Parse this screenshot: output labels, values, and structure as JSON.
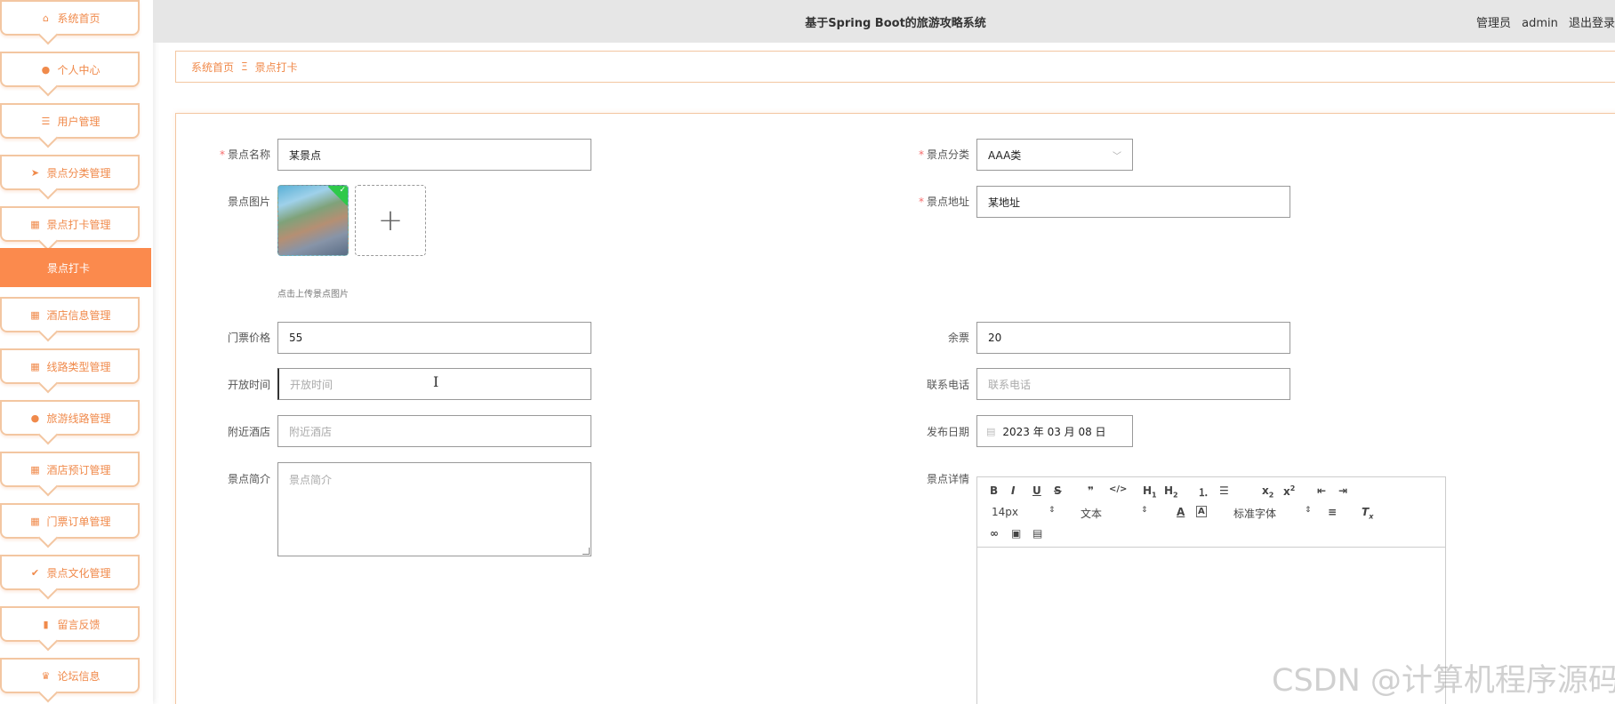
{
  "app": {
    "title": "基于Spring Boot的旅游攻略系统"
  },
  "header": {
    "role": "管理员",
    "username": "admin",
    "logout": "退出登录"
  },
  "sidebar": {
    "items": [
      {
        "label": "系统首页",
        "icon": "home-icon",
        "glyph": "⌂"
      },
      {
        "label": "个人中心",
        "icon": "user-icon",
        "glyph": "●"
      },
      {
        "label": "用户管理",
        "icon": "list-icon",
        "glyph": "☰"
      },
      {
        "label": "景点分类管理",
        "icon": "send-icon",
        "glyph": "➤"
      },
      {
        "label": "景点打卡管理",
        "icon": "grid-icon",
        "glyph": "▦"
      },
      {
        "label": "酒店信息管理",
        "icon": "grid-icon",
        "glyph": "▦"
      },
      {
        "label": "线路类型管理",
        "icon": "grid-icon",
        "glyph": "▦"
      },
      {
        "label": "旅游线路管理",
        "icon": "user-icon",
        "glyph": "●"
      },
      {
        "label": "酒店预订管理",
        "icon": "grid-icon",
        "glyph": "▦"
      },
      {
        "label": "门票订单管理",
        "icon": "grid-icon",
        "glyph": "▦"
      },
      {
        "label": "景点文化管理",
        "icon": "clipboard-icon",
        "glyph": "✔"
      },
      {
        "label": "留言反馈",
        "icon": "bar-chart-icon",
        "glyph": "▮"
      },
      {
        "label": "论坛信息",
        "icon": "trophy-icon",
        "glyph": "♛"
      }
    ],
    "active_sub": "景点打卡"
  },
  "breadcrumb": {
    "home": "系统首页",
    "separator": "Ξ",
    "current": "景点打卡"
  },
  "form": {
    "name": {
      "label": "景点名称",
      "value": "某景点"
    },
    "category": {
      "label": "景点分类",
      "value": "AAA类"
    },
    "image": {
      "label": "景点图片",
      "hint": "点击上传景点图片"
    },
    "address": {
      "label": "景点地址",
      "value": "某地址"
    },
    "price": {
      "label": "门票价格",
      "value": "55"
    },
    "remaining": {
      "label": "余票",
      "value": "20"
    },
    "open_time": {
      "label": "开放时间",
      "placeholder": "开放时间"
    },
    "phone": {
      "label": "联系电话",
      "placeholder": "联系电话"
    },
    "hotel": {
      "label": "附近酒店",
      "placeholder": "附近酒店"
    },
    "publish_date": {
      "label": "发布日期",
      "value": "2023 年 03 月 08 日"
    },
    "intro": {
      "label": "景点简介",
      "placeholder": "景点简介"
    },
    "detail": {
      "label": "景点详情"
    }
  },
  "editor": {
    "size": "14px",
    "format": "文本",
    "font": "标准字体"
  },
  "watermark": "CSDN @计算机程序源码",
  "colors": {
    "accent": "#f08a4b",
    "active_bg": "#fb8a4d",
    "border": "#f3c6a1",
    "topbar": "#e6e6e6"
  }
}
